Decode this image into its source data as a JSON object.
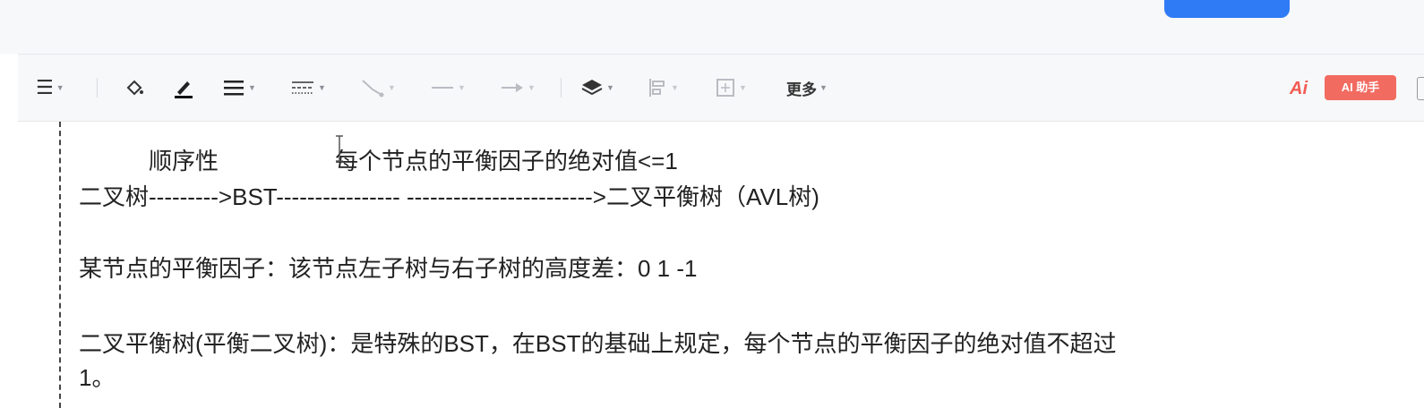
{
  "toolbar": {
    "items": [
      {
        "icon": "align-icon",
        "glyph": "☰",
        "has_caret": true,
        "disabled": false
      },
      {
        "icon": "fill-color-icon",
        "glyph": "◇",
        "has_caret": false,
        "disabled": false
      },
      {
        "icon": "line-color-icon",
        "glyph": "✎",
        "has_caret": false,
        "disabled": false
      },
      {
        "icon": "line-width-icon",
        "glyph": "≡",
        "has_caret": true,
        "disabled": false
      },
      {
        "icon": "line-style-icon",
        "glyph": "┄",
        "has_caret": true,
        "disabled": false
      },
      {
        "icon": "connector-icon",
        "glyph": "↘",
        "has_caret": true,
        "disabled": true
      },
      {
        "icon": "line-icon",
        "glyph": "—",
        "has_caret": true,
        "disabled": true
      },
      {
        "icon": "arrow-icon",
        "glyph": "→",
        "has_caret": true,
        "disabled": true
      },
      {
        "icon": "layers-icon",
        "glyph": "◈",
        "has_caret": true,
        "disabled": false
      },
      {
        "icon": "align-objects-icon",
        "glyph": "⊏",
        "has_caret": true,
        "disabled": true
      },
      {
        "icon": "size-icon",
        "glyph": "⊞",
        "has_caret": true,
        "disabled": true
      }
    ],
    "more_label": "更多",
    "ai_logo": "Ai",
    "ai_assistant_label": "AI 助手"
  },
  "editor": {
    "lines": [
      "　　　顺序性　　　　　每个节点的平衡因子的绝对值<=1",
      "二叉树--------->BST---------------- ------------------------>二叉平衡树（AVL树)",
      "某节点的平衡因子：该节点左子树与右子树的高度差：0 1 -1",
      "二叉平衡树(平衡二叉树)：是特殊的BST，在BST的基础上规定，每个节点的平衡因子的绝对值不超过",
      "1。"
    ]
  },
  "colors": {
    "accent": "#2f7bf5",
    "ai_badge": "#f26b61",
    "toolbar_bg": "#f7f8fa"
  }
}
